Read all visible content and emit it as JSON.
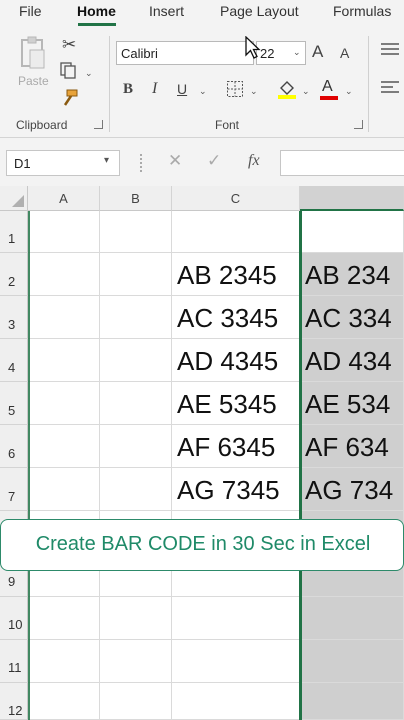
{
  "ribbon_tabs": {
    "file": "File",
    "home": "Home",
    "insert": "Insert",
    "page_layout": "Page Layout",
    "formulas": "Formulas"
  },
  "clipboard": {
    "paste_label": "Paste",
    "group_label": "Clipboard",
    "icons": [
      "paste-icon",
      "cut-icon",
      "copy-icon",
      "format-painter-icon"
    ]
  },
  "font": {
    "font_name": "Calibri",
    "font_size": "22",
    "grow_label": "A",
    "shrink_label": "A",
    "bold_label": "B",
    "italic_label": "I",
    "underline_label": "U",
    "font_color_label": "A",
    "group_label": "Font",
    "highlight_color": "#ffff00",
    "font_color": "#e00000"
  },
  "formula_bar": {
    "name_box": "D1",
    "cancel_icon": "✕",
    "enter_icon": "✓",
    "fx_label": "fx",
    "formula": ""
  },
  "grid": {
    "columns": [
      "A",
      "B",
      "C",
      ""
    ],
    "rows": [
      "1",
      "2",
      "3",
      "4",
      "5",
      "6",
      "7",
      "9",
      "10",
      "11",
      "12"
    ],
    "cells_c": [
      "",
      "AB 2345",
      "AC 3345",
      "AD 4345",
      "AE 5345",
      "AF 6345",
      "AG 7345"
    ],
    "cells_d": [
      "",
      "AB 234",
      "AC 334",
      "AD 434",
      "AE 534",
      "AF 634",
      "AG 734"
    ],
    "selection_color": "#217346"
  },
  "banner": {
    "text": "Create BAR CODE in 30 Sec in Excel",
    "color": "#1f8a68"
  }
}
